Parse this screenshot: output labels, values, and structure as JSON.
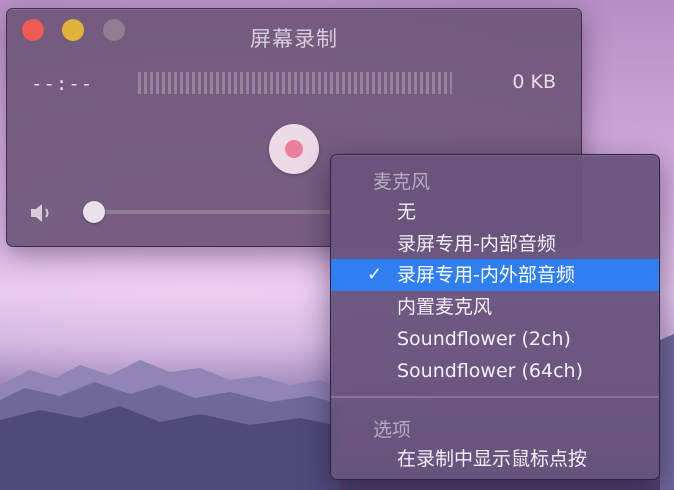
{
  "window": {
    "title": "屏幕录制",
    "elapsed_time": "--:--",
    "file_size": "0 KB",
    "volume_level": 0.03
  },
  "menu": {
    "microphone_header": "麦克风",
    "microphone_items": [
      {
        "label": "无",
        "selected": false
      },
      {
        "label": "录屏专用-内部音频",
        "selected": false
      },
      {
        "label": "录屏专用-内外部音频",
        "selected": true
      },
      {
        "label": "内置麦克风",
        "selected": false
      },
      {
        "label": "Soundflower (2ch)",
        "selected": false
      },
      {
        "label": "Soundflower (64ch)",
        "selected": false
      }
    ],
    "options_header": "选项",
    "options_items": [
      {
        "label": "在录制中显示鼠标点按",
        "selected": false
      }
    ],
    "check_glyph": "✓"
  },
  "colors": {
    "selection": "#2f7ff2",
    "close": "#ee5b55",
    "minimize": "#e0b33b",
    "record_dot": "#ee7f9b"
  }
}
